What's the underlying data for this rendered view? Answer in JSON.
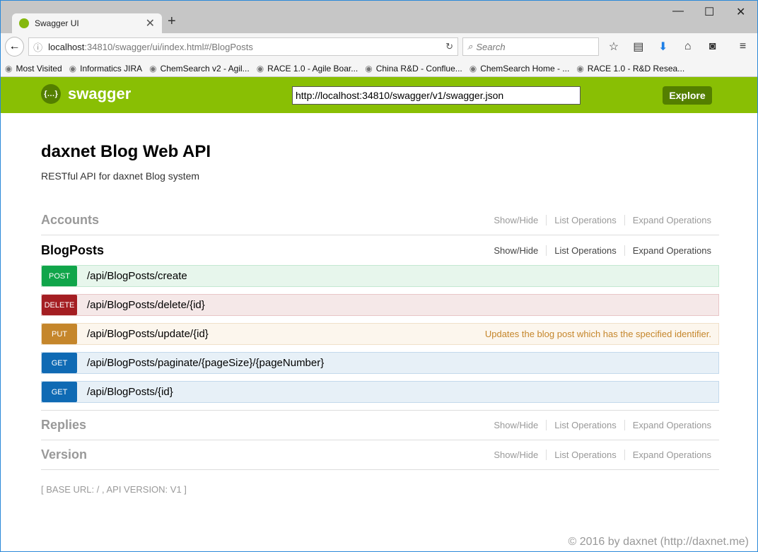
{
  "browser": {
    "tab_title": "Swagger UI",
    "url_host": "localhost",
    "url_rest": ":34810/swagger/ui/index.html#/BlogPosts",
    "search_placeholder": "Search",
    "bookmarks": [
      "Most Visited",
      "Informatics JIRA",
      "ChemSearch v2 - Agil...",
      "RACE 1.0 - Agile Boar...",
      "China R&D - Conflue...",
      "ChemSearch Home - ...",
      "RACE 1.0 - R&D Resea..."
    ]
  },
  "header": {
    "logo": "swagger",
    "spec_url": "http://localhost:34810/swagger/v1/swagger.json",
    "explore": "Explore"
  },
  "api": {
    "title": "daxnet Blog Web API",
    "description": "RESTful API for daxnet Blog system"
  },
  "ops_labels": {
    "show_hide": "Show/Hide",
    "list": "List Operations",
    "expand": "Expand Operations"
  },
  "resources": [
    {
      "name": "Accounts"
    },
    {
      "name": "BlogPosts"
    },
    {
      "name": "Replies"
    },
    {
      "name": "Version"
    }
  ],
  "endpoints": [
    {
      "method": "POST",
      "path": "/api/BlogPosts/create",
      "summary": ""
    },
    {
      "method": "DELETE",
      "path": "/api/BlogPosts/delete/{id}",
      "summary": ""
    },
    {
      "method": "PUT",
      "path": "/api/BlogPosts/update/{id}",
      "summary": "Updates the blog post which has the specified identifier."
    },
    {
      "method": "GET",
      "path": "/api/BlogPosts/paginate/{pageSize}/{pageNumber}",
      "summary": ""
    },
    {
      "method": "GET",
      "path": "/api/BlogPosts/{id}",
      "summary": ""
    }
  ],
  "info": "[ BASE URL: / , API VERSION: V1 ]",
  "copyright": "© 2016 by daxnet (http://daxnet.me)",
  "colors": {
    "POST": "#10a54a",
    "DELETE": "#a41e22",
    "PUT": "#c5862b",
    "GET": "#0f6ab4",
    "brand": "#89bf04"
  }
}
